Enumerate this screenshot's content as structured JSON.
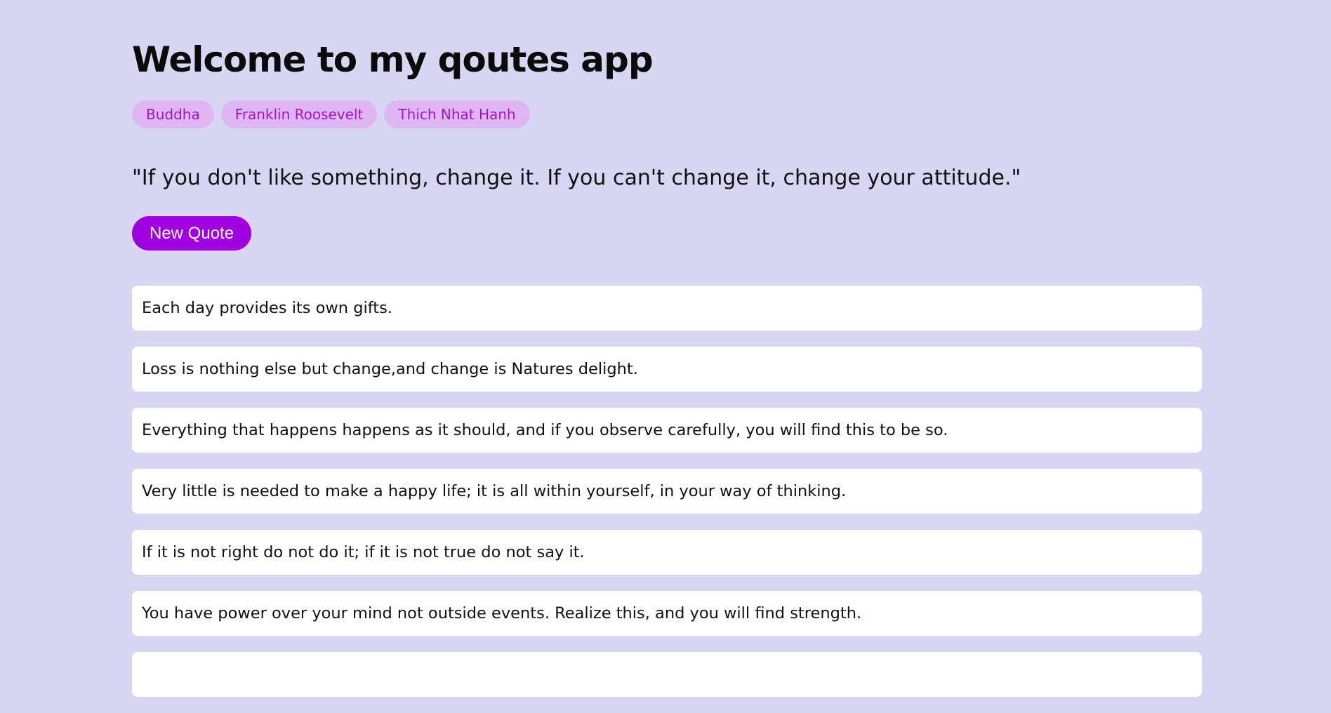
{
  "page": {
    "title": "Welcome to my qoutes app"
  },
  "authors": [
    {
      "label": "Buddha"
    },
    {
      "label": "Franklin Roosevelt"
    },
    {
      "label": "Thich Nhat Hanh"
    }
  ],
  "featured_quote": "\"If you don't like something, change it. If you can't change it, change your attitude.\"",
  "new_quote_button": "New Quote",
  "quotes": [
    {
      "text": "Each day provides its own gifts."
    },
    {
      "text": "Loss is nothing else but change,and change is Natures delight."
    },
    {
      "text": "Everything that happens happens as it should, and if you observe carefully, you will find this to be so."
    },
    {
      "text": "Very little is needed to make a happy life; it is all within yourself, in your way of thinking."
    },
    {
      "text": "If it is not right do not do it; if it is not true do not say it."
    },
    {
      "text": "You have power over your mind not outside events. Realize this, and you will find strength."
    },
    {
      "text": ""
    }
  ],
  "colors": {
    "background": "#d8d6f2",
    "tag_background": "#deb6f2",
    "tag_text": "#a512d6",
    "button": "#a000e0",
    "card": "#ffffff"
  }
}
